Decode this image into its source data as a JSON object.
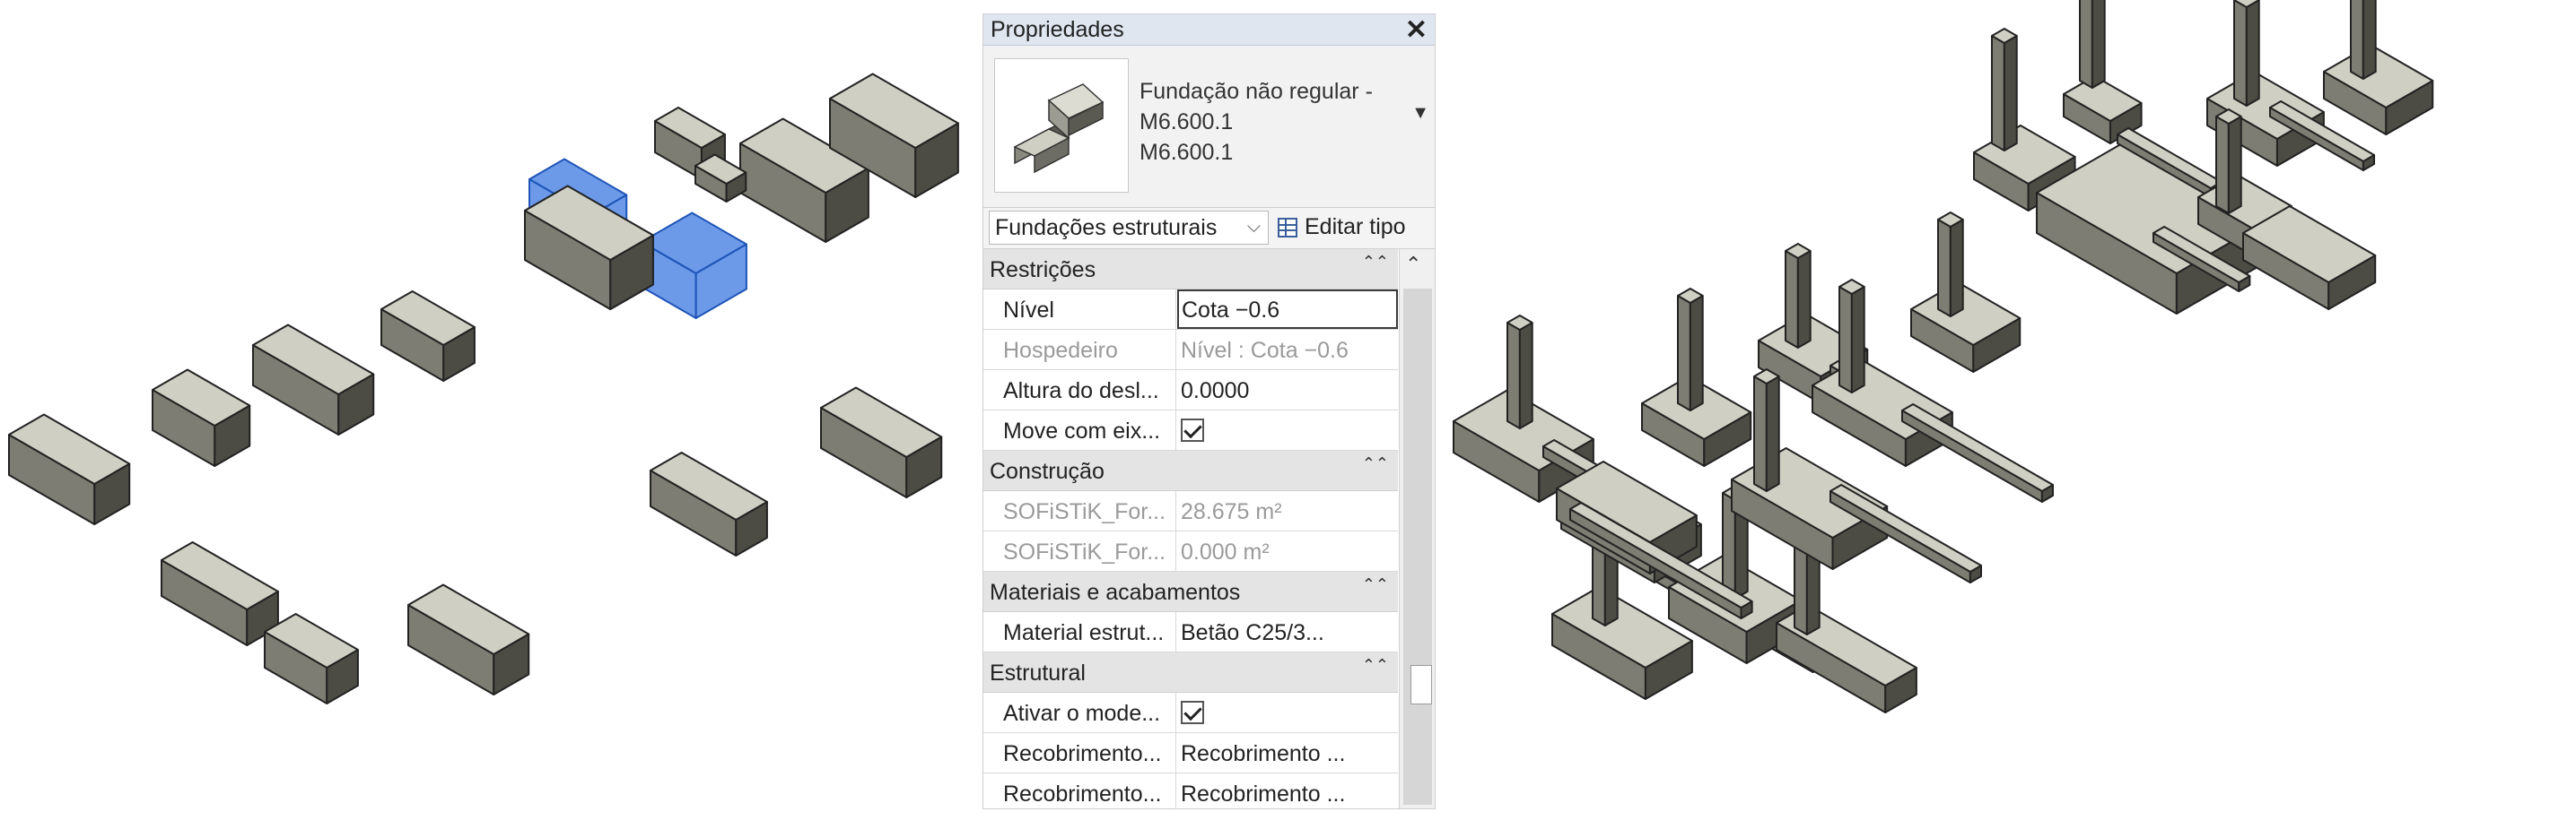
{
  "left_view": {
    "elements": 19,
    "selected_element": "irregular-foundation"
  },
  "properties": {
    "title": "Propriedades",
    "type_selector": {
      "line1": "Fundação não regular -",
      "line2": "M6.600.1",
      "line3": "M6.600.1"
    },
    "category": "Fundações estruturais",
    "edit_type_label": "Editar tipo",
    "sections": [
      {
        "label": "Restrições",
        "rows": [
          {
            "name": "Nível",
            "value": "Cota −0.6",
            "readonly": false,
            "editing": true
          },
          {
            "name": "Hospedeiro",
            "value": "Nível : Cota −0.6",
            "readonly": true
          },
          {
            "name": "Altura do desl...",
            "value": "0.0000",
            "readonly": false
          },
          {
            "name": "Move com eix...",
            "value": "",
            "checkbox": true,
            "checked": true
          }
        ]
      },
      {
        "label": "Construção",
        "rows": [
          {
            "name": "SOFiSTiK_For...",
            "value": "28.675 m²",
            "readonly": true
          },
          {
            "name": "SOFiSTiK_For...",
            "value": "0.000 m²",
            "readonly": true
          }
        ]
      },
      {
        "label": "Materiais e acabamentos",
        "rows": [
          {
            "name": "Material estrut...",
            "value": "Betão C25/3...",
            "readonly": false,
            "tail": true
          }
        ]
      },
      {
        "label": "Estrutural",
        "rows": [
          {
            "name": "Ativar o mode...",
            "value": "",
            "checkbox": true,
            "checked": true
          },
          {
            "name": "Recobrimento...",
            "value": "Recobrimento ...",
            "readonly": false
          },
          {
            "name": "Recobrimento...",
            "value": "Recobrimento ...",
            "readonly": false
          }
        ]
      }
    ],
    "icons": {
      "close": "close-icon",
      "dropdown": "dropdown-arrow-icon",
      "edit_type": "edit-type-icon",
      "collapse": "collapse-chevron-icon"
    }
  },
  "colors": {
    "block_top": "#cfcfc4",
    "block_left": "#7d7d73",
    "block_right": "#4c4c45",
    "selected": "#3b78e0"
  }
}
